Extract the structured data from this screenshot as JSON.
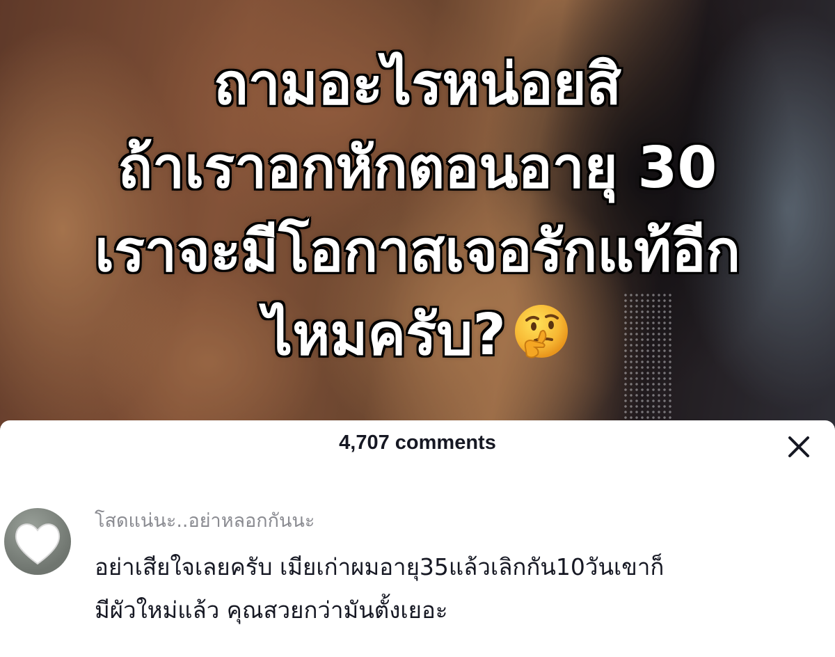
{
  "video": {
    "caption_lines": [
      "ถามอะไรหน่อยสิ",
      "ถ้าเราอกหักตอนอายุ 30",
      "เราจะมีโอกาสเจอรักแท้อีก",
      "ไหมครับ?"
    ],
    "caption_emoji": "thinking-face"
  },
  "comments_sheet": {
    "title": "4,707 comments",
    "close_icon": "close-icon",
    "comments": [
      {
        "username": "โสดแน่นะ..อย่าหลอกกันนะ",
        "avatar_icon": "heart-icon",
        "text_lines": [
          "อย่าเสียใจเลยครับ เมียเก่าผมอายุ35แล้วเลิกกัน10วันเขาก็",
          "มีผัวใหม่แล้ว คุณสวยกว่ามันตั้งเยอะ"
        ]
      }
    ]
  }
}
